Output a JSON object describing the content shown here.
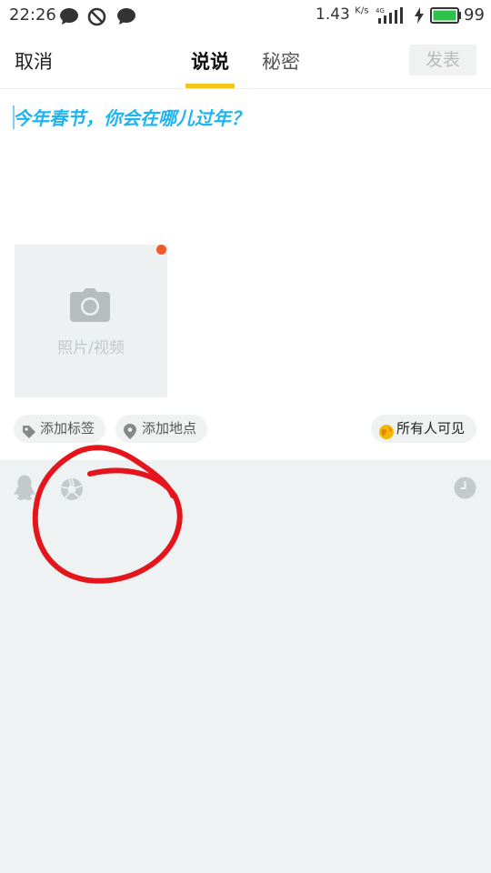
{
  "status_bar": {
    "time": "22:26",
    "net_speed": "1.43",
    "net_speed_unit": "K/s",
    "network_type": "4G",
    "battery_level": "99",
    "icons": [
      "chat-bubble-icon",
      "blocked-icon",
      "chat-bubble-icon",
      "signal-icon",
      "charging-bolt-icon",
      "battery-icon"
    ]
  },
  "header": {
    "cancel_label": "取消",
    "tabs": [
      {
        "label": "说说",
        "active": true
      },
      {
        "label": "秘密",
        "active": false
      }
    ],
    "publish_label": "发表",
    "accent_color": "#f5c518"
  },
  "compose": {
    "prompt": "今年春节，你会在哪儿过年？",
    "prompt_color": "#1fb4f0"
  },
  "media": {
    "label": "照片/视频",
    "icon": "camera-icon",
    "badge_color": "#f05a28"
  },
  "chips": {
    "tag_label": "添加标签",
    "location_label": "添加地点",
    "visibility_label": "所有人可见"
  },
  "toolbar": {
    "icons": [
      "qq-penguin-icon",
      "shutter-icon",
      "clock-icon"
    ]
  },
  "annotation": {
    "color": "#e5151d"
  }
}
